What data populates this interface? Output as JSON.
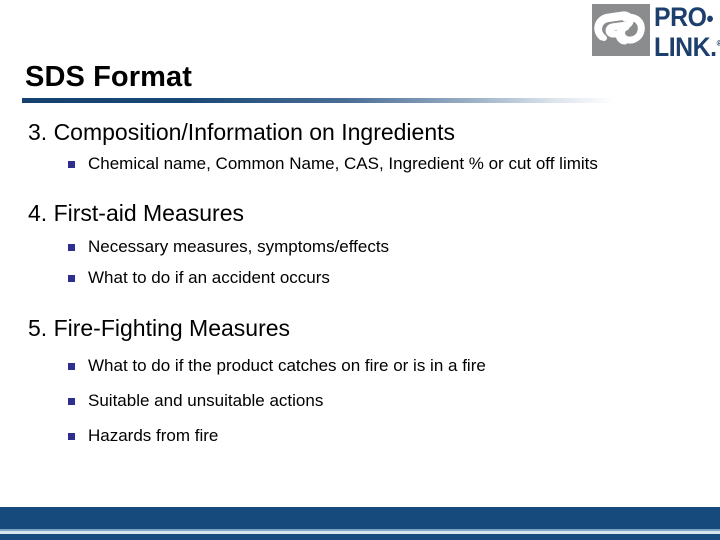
{
  "slide": {
    "title": "SDS Format",
    "logo": {
      "mark_name": "chain-link-icon",
      "line1": "PRO",
      "dot": "•",
      "line2": "LINK",
      "period": ".",
      "tm": "®"
    },
    "sections": [
      {
        "heading": "3. Composition/Information on Ingredients",
        "bullets": [
          "Chemical name, Common Name, CAS, Ingredient % or cut off limits"
        ]
      },
      {
        "heading": "4. First-aid Measures",
        "bullets": [
          "Necessary measures, symptoms/effects",
          "What to do if an accident occurs"
        ]
      },
      {
        "heading": "5. Fire-Fighting Measures",
        "bullets": [
          "What to do if the product catches on fire or is in a fire",
          "Suitable and unsuitable actions",
          "Hazards from fire"
        ]
      }
    ]
  },
  "colors": {
    "brand_navy": "#1d3f6e",
    "rule_navy": "#15416f",
    "footer_navy": "#174a7c",
    "bullet_blue": "#2c2f8f",
    "logo_gray": "#8a8c8e"
  }
}
